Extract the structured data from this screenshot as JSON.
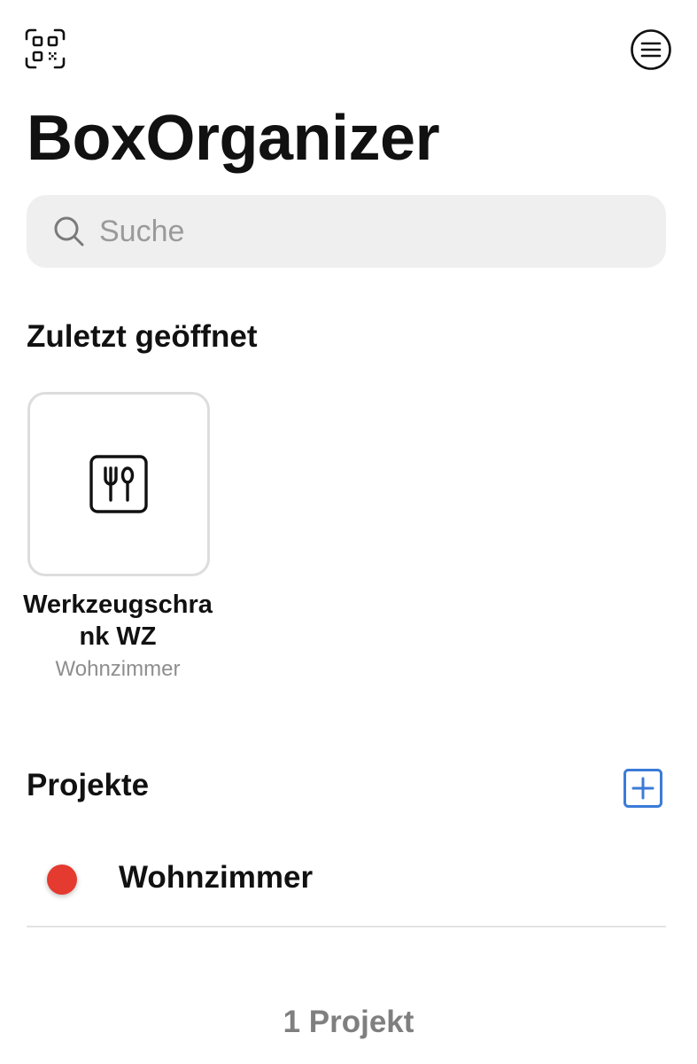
{
  "header": {
    "app_title": "BoxOrganizer",
    "qr_icon": "qr-code-scan-icon",
    "menu_icon": "menu-circle-icon"
  },
  "search": {
    "placeholder": "Suche",
    "value": "",
    "icon": "search-icon"
  },
  "recent": {
    "section_title": "Zuletzt geöffnet",
    "items": [
      {
        "name": "Werkzeugschrank WZ",
        "location": "Wohnzimmer",
        "icon": "kitchen-utensils-icon"
      }
    ]
  },
  "projects": {
    "section_title": "Projekte",
    "add_icon": "add-square-icon",
    "items": [
      {
        "name": "Wohnzimmer",
        "color": "#e53a2f"
      }
    ],
    "count_label": "1 Projekt"
  },
  "colors": {
    "accent": "#3b7bd8",
    "project_red": "#e53a2f",
    "search_bg": "#efefef",
    "muted_text": "#8e8e8e"
  }
}
